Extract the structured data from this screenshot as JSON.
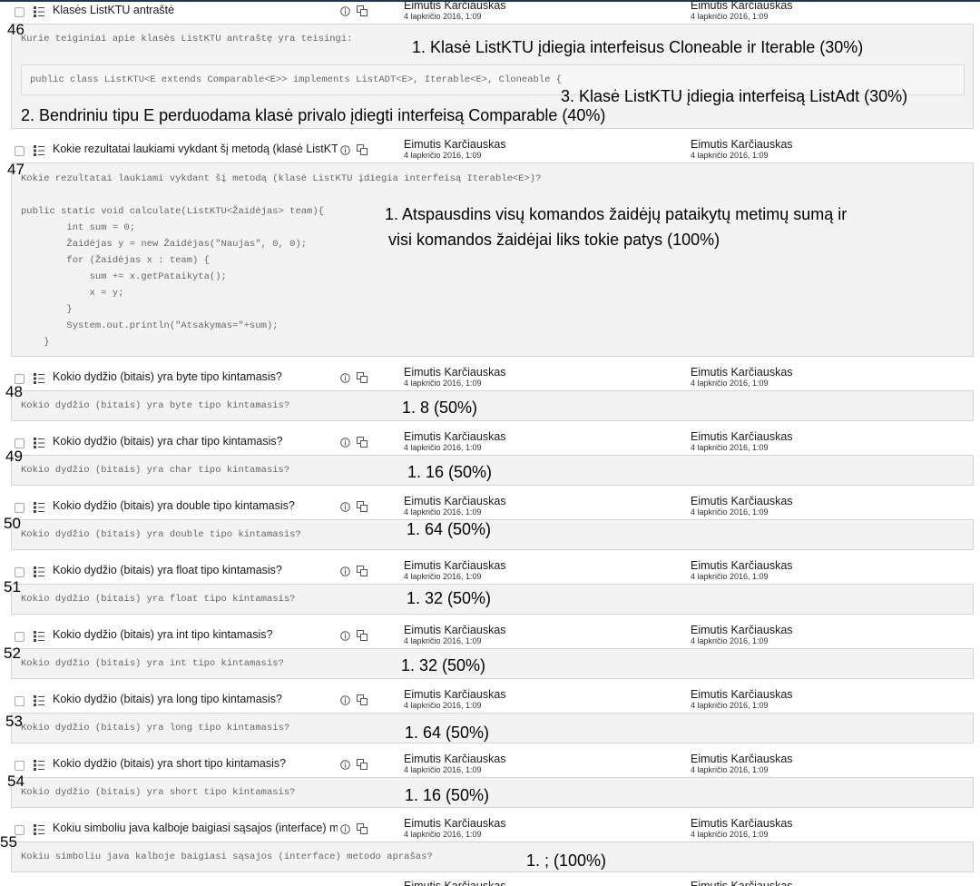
{
  "author": "Eimutis Karčiauskas",
  "date": "4 lapkričio 2016, 1:09",
  "questions": [
    {
      "number": "46",
      "name": "Klasės ListKTU antraštė",
      "text": "Kurie teiginiai apie klasės ListKTU antraštę yra teisingi:",
      "code": "public class ListKTU<E extends Comparable<E>> implements ListADT<E>, Iterable<E>, Cloneable {",
      "answers": [
        "1. Klasė ListKTU įdiegia interfeisus Cloneable ir Iterable (30%)",
        "3. Klasė ListKTU įdiegia interfeisą ListAdt (30%)",
        "2. Bendriniu tipu E perduodama klasė privalo įdiegti interfeisą Comparable (40%)"
      ]
    },
    {
      "number": "47",
      "name": "Kokie rezultatai laukiami vykdant šį metodą (klasė ListKTU įdiegia interfeisą Iterable<E>)?",
      "text": "Kokie rezultatai laukiami vykdant šį metodą (klasė ListKTU įdiegia interfeisą Iterable<E>)?",
      "code_lines": [
        "public static void calculate(ListKTU<Žaidėjas> team){",
        "        int sum = 0;",
        "        Žaidėjas y = new Žaidėjas(\"Naujas\", 0, 0);",
        "        for (Žaidėjas x : team) {",
        "            sum += x.getPataikyta();",
        "            x = y;",
        "        }",
        "        System.out.println(\"Atsakymas=\"+sum);",
        "    }"
      ],
      "answers": [
        "1. Atspausdins visų komandos žaidėjų pataikytų metimų sumą ir",
        "visi komandos žaidėjai liks tokie patys (100%)"
      ]
    },
    {
      "number": "48",
      "name": "Kokio dydžio (bitais) yra byte tipo kintamasis?",
      "text": "Kokio dydžio (bitais) yra byte tipo kintamasis?",
      "answers": [
        "1. 8 (50%)"
      ]
    },
    {
      "number": "49",
      "name": "Kokio dydžio (bitais) yra char tipo kintamasis?",
      "text": "Kokio dydžio (bitais) yra char tipo kintamasis?",
      "answers": [
        "1. 16 (50%)"
      ]
    },
    {
      "number": "50",
      "name": "Kokio dydžio (bitais) yra double tipo kintamasis?",
      "text": "Kokio dydžio (bitais) yra double tipo kintamasis?",
      "answers": [
        "1. 64 (50%)"
      ]
    },
    {
      "number": "51",
      "name": "Kokio dydžio (bitais) yra float tipo kintamasis?",
      "text": "Kokio dydžio (bitais) yra float tipo kintamasis?",
      "answers": [
        "1. 32 (50%)"
      ]
    },
    {
      "number": "52",
      "name": "Kokio dydžio (bitais) yra int tipo kintamasis?",
      "text": "Kokio dydžio (bitais) yra int tipo kintamasis?",
      "answers": [
        "1. 32 (50%)"
      ]
    },
    {
      "number": "53",
      "name": "Kokio dydžio (bitais) yra long tipo kintamasis?",
      "text": "Kokio dydžio (bitais) yra long tipo kintamasis?",
      "answers": [
        "1. 64 (50%)"
      ]
    },
    {
      "number": "54",
      "name": "Kokio dydžio (bitais) yra short tipo kintamasis?",
      "text": "Kokio dydžio (bitais) yra short tipo kintamasis?",
      "answers": [
        "1. 16 (50%)"
      ]
    },
    {
      "number": "55",
      "name": "Kokiu simboliu java kalboje baigiasi sąsajos (interface) metodo aprašas?",
      "text": "Kokiu simboliu java kalboje baigiasi sąsajos (interface) metodo aprašas?",
      "answers": [
        "1. ; (100%)"
      ]
    }
  ]
}
